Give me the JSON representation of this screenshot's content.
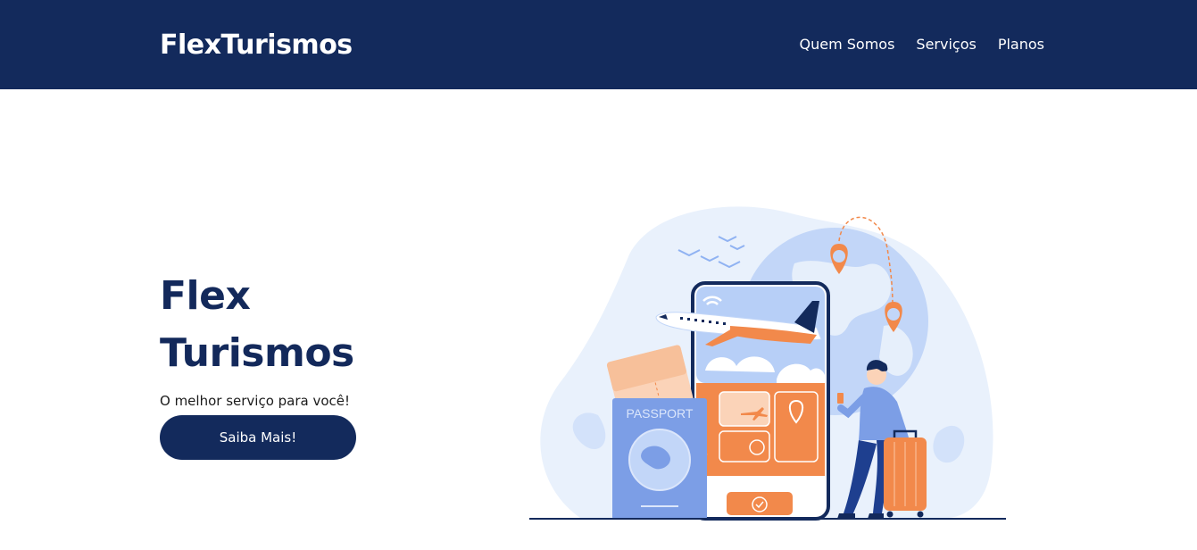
{
  "header": {
    "brand": "FlexTurismos",
    "nav": [
      {
        "label": "Quem Somos"
      },
      {
        "label": "Serviços"
      },
      {
        "label": "Planos"
      }
    ]
  },
  "hero": {
    "title_line1": "Flex",
    "title_line2": "Turismos",
    "subtitle": "O melhor serviço para você!",
    "cta_label": "Saiba Mais!"
  },
  "illustration": {
    "passport_label": "PASSPORT",
    "colors": {
      "navy": "#132a5c",
      "orange": "#f2894b",
      "light_blue": "#e6effb",
      "mid_blue": "#8fb2f2",
      "passport_blue": "#7c9ee6"
    }
  }
}
